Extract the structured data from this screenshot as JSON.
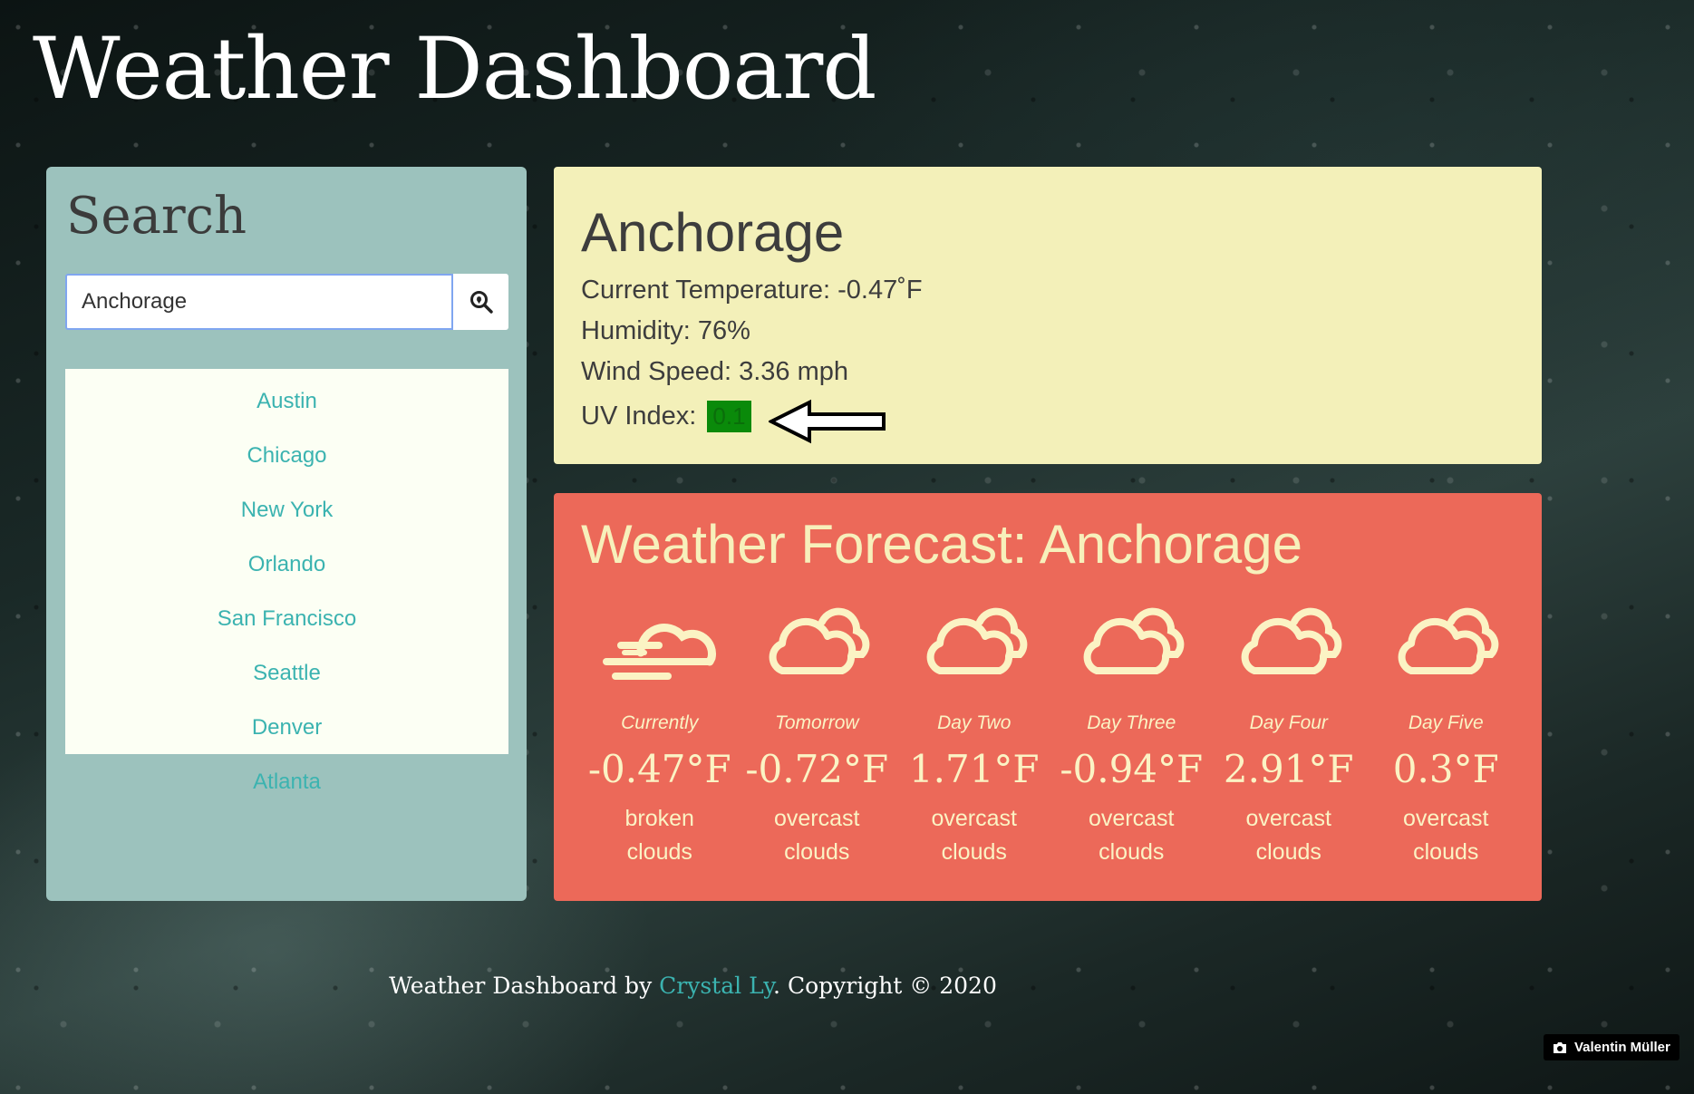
{
  "header": {
    "title": "Weather Dashboard"
  },
  "search": {
    "heading": "Search",
    "input_value": "Anchorage",
    "button_icon": "search-location-icon",
    "cities": [
      "Austin",
      "Chicago",
      "New York",
      "Orlando",
      "San Francisco",
      "Seattle",
      "Denver",
      "Atlanta"
    ]
  },
  "current": {
    "city": "Anchorage",
    "temperature_label": "Current Temperature: -0.47˚F",
    "humidity_label": "Humidity: 76%",
    "wind_label": "Wind Speed: 3.36 mph",
    "uv_label": "UV Index:",
    "uv_value": "0.1",
    "uv_color": "#0a8a0a"
  },
  "forecast": {
    "title": "Weather Forecast: Anchorage",
    "days": [
      {
        "label": "Currently",
        "temp": "-0.47°F",
        "desc": "broken clouds",
        "icon": "fog-cloud-icon"
      },
      {
        "label": "Tomorrow",
        "temp": "-0.72°F",
        "desc": "overcast clouds",
        "icon": "clouds-icon"
      },
      {
        "label": "Day Two",
        "temp": "1.71°F",
        "desc": "overcast clouds",
        "icon": "clouds-icon"
      },
      {
        "label": "Day Three",
        "temp": "-0.94°F",
        "desc": "overcast clouds",
        "icon": "clouds-icon"
      },
      {
        "label": "Day Four",
        "temp": "2.91°F",
        "desc": "overcast clouds",
        "icon": "clouds-icon"
      },
      {
        "label": "Day Five",
        "temp": "0.3°F",
        "desc": "overcast clouds",
        "icon": "clouds-icon"
      }
    ]
  },
  "footer": {
    "prefix": "Weather Dashboard by ",
    "author": "Crystal Ly",
    "suffix": ". Copyright © 2020"
  },
  "photo_credit": {
    "name": "Valentin Müller",
    "icon": "camera-icon"
  },
  "colors": {
    "search_panel": "#9cc2bd",
    "current_card": "#f3f0b9",
    "forecast_card": "#ec6959",
    "link": "#3bb3b0"
  }
}
